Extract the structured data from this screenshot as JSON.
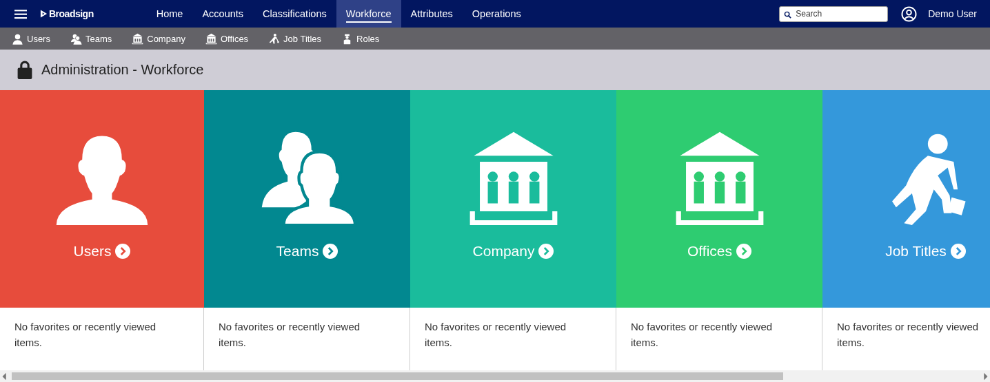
{
  "brand": "Broadsign",
  "nav": [
    {
      "label": "Home",
      "selected": false
    },
    {
      "label": "Accounts",
      "selected": false
    },
    {
      "label": "Classifications",
      "selected": false
    },
    {
      "label": "Workforce",
      "selected": true
    },
    {
      "label": "Attributes",
      "selected": false
    },
    {
      "label": "Operations",
      "selected": false
    }
  ],
  "search": {
    "placeholder": "Search"
  },
  "user": "Demo User",
  "subnav": [
    {
      "label": "Users",
      "kind": "user"
    },
    {
      "label": "Teams",
      "kind": "team"
    },
    {
      "label": "Company",
      "kind": "building"
    },
    {
      "label": "Offices",
      "kind": "building"
    },
    {
      "label": "Job Titles",
      "kind": "worker"
    },
    {
      "label": "Roles",
      "kind": "role"
    }
  ],
  "page_title": "Administration - Workforce",
  "tiles": [
    {
      "label": "Users",
      "kind": "user",
      "color": "#e74c3c",
      "note": "No favorites or recently viewed items."
    },
    {
      "label": "Teams",
      "kind": "team",
      "color": "#028890",
      "note": "No favorites or recently viewed items."
    },
    {
      "label": "Company",
      "kind": "building",
      "color": "#1abc9c",
      "note": "No favorites or recently viewed items."
    },
    {
      "label": "Offices",
      "kind": "building",
      "color": "#2ecc71",
      "note": "No favorites or recently viewed items."
    },
    {
      "label": "Job Titles",
      "kind": "worker",
      "color": "#3498db",
      "note": "No favorites or recently viewed items."
    }
  ]
}
